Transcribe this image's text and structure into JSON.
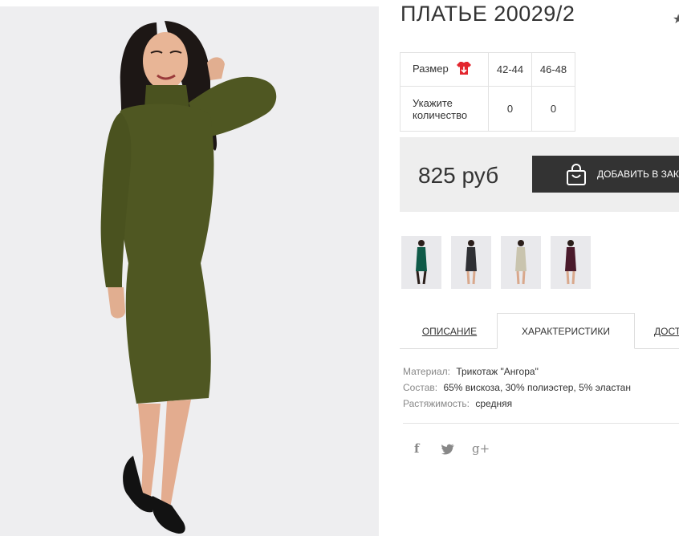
{
  "product": {
    "title": "ПЛАТЬЕ 20029/2",
    "star": "★"
  },
  "sizes": {
    "size_label": "Размер",
    "qty_label_line1": "Укажите",
    "qty_label_line2": "количество",
    "columns": [
      "42-44",
      "46-48"
    ],
    "quantities": [
      "0",
      "0"
    ]
  },
  "price": {
    "amount": "825 руб",
    "add_to_cart": "ДОБАВИТЬ В ЗАКАЗ"
  },
  "thumbnails": [
    {
      "color_name": "green",
      "dress_color": "#0f5a48"
    },
    {
      "color_name": "dark-grey",
      "dress_color": "#2f3034"
    },
    {
      "color_name": "beige",
      "dress_color": "#c9c4ae"
    },
    {
      "color_name": "burgundy",
      "dress_color": "#4a1a2b"
    }
  ],
  "tabs": [
    "ОПИСАНИЕ",
    "ХАРАКТЕРИСТИКИ",
    "ДОСТ"
  ],
  "specs": [
    {
      "key": "Материал:",
      "value": "Трикотаж \"Ангора\""
    },
    {
      "key": "Состав:",
      "value": "65% вискоза, 30% полиэстер, 5% эластан"
    },
    {
      "key": "Растяжимость:",
      "value": "средняя"
    }
  ],
  "social": {
    "facebook": "f",
    "google_plus": "g+"
  },
  "colors": {
    "main_dress": "#4f5722",
    "button_bg": "#333333",
    "price_box_bg": "#eeeeee",
    "size_icon": "#e3262e"
  }
}
